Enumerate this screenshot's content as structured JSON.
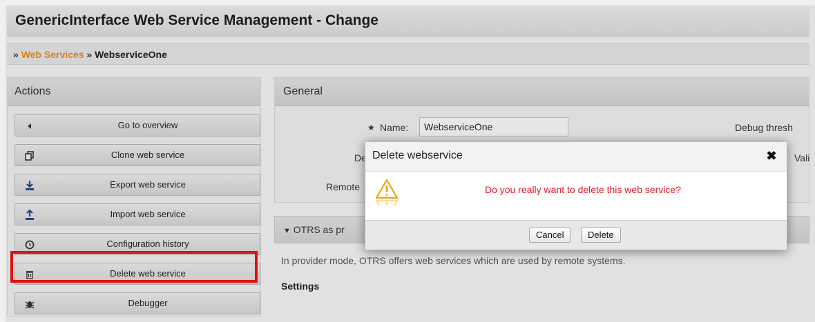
{
  "page_title": "GenericInterface Web Service Management - Change",
  "breadcrumb": {
    "sep1": "»",
    "link": "Web Services",
    "sep2": "»",
    "current": "WebserviceOne"
  },
  "actions": {
    "header": "Actions",
    "items": [
      {
        "label": "Go to overview",
        "icon": "chevron-left-icon"
      },
      {
        "label": "Clone web service",
        "icon": "clone-icon"
      },
      {
        "label": "Export web service",
        "icon": "download-icon"
      },
      {
        "label": "Import web service",
        "icon": "upload-icon"
      },
      {
        "label": "Configuration history",
        "icon": "clock-icon"
      },
      {
        "label": "Delete web service",
        "icon": "trash-icon"
      },
      {
        "label": "Debugger",
        "icon": "bug-icon"
      }
    ]
  },
  "general": {
    "header": "General",
    "name_required": "★",
    "name_label": "Name:",
    "name_value": "WebserviceOne",
    "desc_label_partial": "De",
    "remote_label_partial": "Remote",
    "debug_label_partial": "Debug thresh",
    "valid_label_partial": "Vali"
  },
  "otrs_section": {
    "toggle": "▼",
    "label_partial": "OTRS as pr",
    "description": "In provider mode, OTRS offers web services which are used by remote systems.",
    "settings_title": "Settings"
  },
  "dialog": {
    "title": "Delete webservice",
    "close": "✖",
    "message": "Do you really want to delete this web service?",
    "cancel": "Cancel",
    "delete": "Delete"
  },
  "colors": {
    "breadcrumb_link": "#e48a1b",
    "warning_text": "#e3182d",
    "highlight_border": "#ee1111",
    "warning_icon": "#f0a30a"
  }
}
